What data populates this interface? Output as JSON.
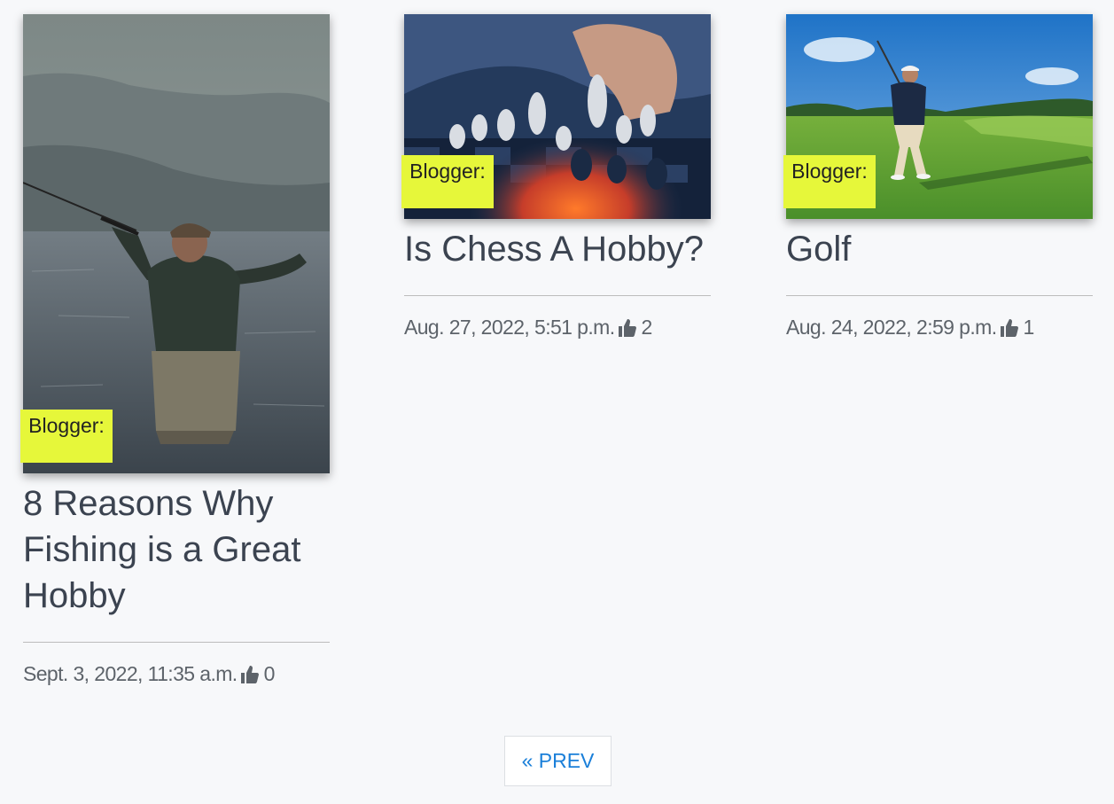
{
  "posts": [
    {
      "badge": "Blogger:",
      "title": "8 Reasons Why Fishing is a Great Hobby",
      "date": "Sept. 3, 2022, 11:35 a.m.",
      "likes": "0",
      "image": "fisherman-casting-in-lake-image"
    },
    {
      "badge": "Blogger:",
      "title": "Is Chess A Hobby?",
      "date": "Aug. 27, 2022, 5:51 p.m.",
      "likes": "2",
      "image": "hand-moving-chess-piece-image"
    },
    {
      "badge": "Blogger:",
      "title": "Golf",
      "date": "Aug. 24, 2022, 2:59 p.m.",
      "likes": "1",
      "image": "golfer-swinging-on-course-image"
    }
  ],
  "pagination": {
    "prev_label": "« PREV"
  },
  "icons": {
    "like": "thumbs-up-icon"
  },
  "colors": {
    "badge_bg": "#e6f73a",
    "link": "#1a7fd9",
    "title": "#3b4350",
    "meta": "#5d636a"
  }
}
